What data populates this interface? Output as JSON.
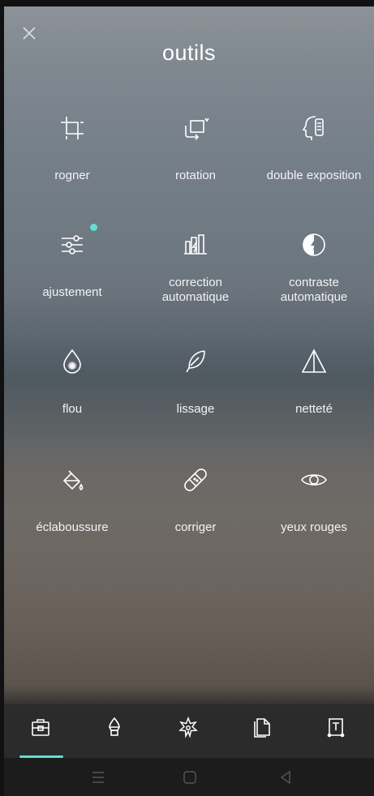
{
  "header": {
    "title": "outils",
    "close_icon": "close-icon"
  },
  "tools": [
    {
      "id": "rogner",
      "label": "rogner",
      "icon": "crop-icon"
    },
    {
      "id": "rotation",
      "label": "rotation",
      "icon": "rotate-icon"
    },
    {
      "id": "double-exposition",
      "label": "double exposition",
      "icon": "double-exposure-icon"
    },
    {
      "id": "ajustement",
      "label": "ajustement",
      "icon": "sliders-icon",
      "badge": true
    },
    {
      "id": "correction-automatique",
      "label": "correction\nautomatique",
      "icon": "auto-fix-icon"
    },
    {
      "id": "contraste-automatique",
      "label": "contraste\nautomatique",
      "icon": "auto-contrast-icon"
    },
    {
      "id": "flou",
      "label": "flou",
      "icon": "blur-drop-icon"
    },
    {
      "id": "lissage",
      "label": "lissage",
      "icon": "feather-icon"
    },
    {
      "id": "nettete",
      "label": "netteté",
      "icon": "sharpen-triangle-icon"
    },
    {
      "id": "eclaboussure",
      "label": "éclaboussure",
      "icon": "paint-bucket-icon"
    },
    {
      "id": "corriger",
      "label": "corriger",
      "icon": "bandage-icon"
    },
    {
      "id": "yeux-rouges",
      "label": "yeux rouges",
      "icon": "eye-icon"
    }
  ],
  "tabbar": {
    "tabs": [
      {
        "icon": "toolbox-icon",
        "active": true
      },
      {
        "icon": "brush-icon",
        "active": false
      },
      {
        "icon": "effects-star-icon",
        "active": false
      },
      {
        "icon": "stickers-page-icon",
        "active": false
      },
      {
        "icon": "text-tool-icon",
        "active": false
      }
    ]
  },
  "system_nav": [
    "menu-icon",
    "home-icon",
    "back-icon"
  ],
  "colors": {
    "accent": "#5ee0d2",
    "tabbar_bg": "#2b2b2b",
    "sysnav_bg": "#1c1c1c",
    "text": "#ffffff"
  }
}
